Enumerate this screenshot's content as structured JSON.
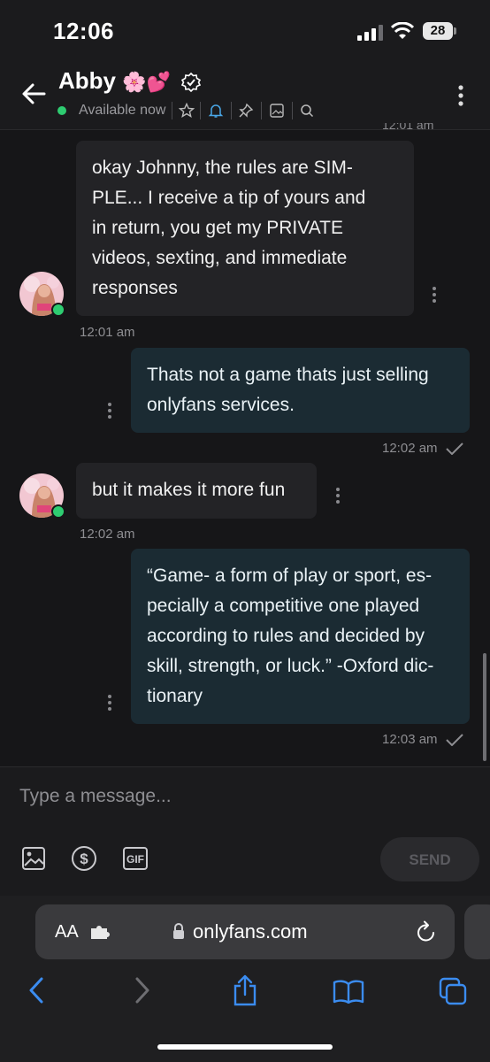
{
  "status_bar": {
    "time": "12:06",
    "battery": "28"
  },
  "header": {
    "name": "Abby",
    "name_emoji": "🌸💕",
    "presence": "Available now"
  },
  "clipped_timestamp": "12:01 am",
  "messages": [
    {
      "direction": "in",
      "text": "okay Johnny, the rules are SIM-PLE... I receive a tip of yours and in return, you get my PRIVATE videos, sexting, and immediate responses",
      "lines": [
        "okay Johnny, the rules are SIM-",
        "PLE... I receive a tip of yours and",
        "in return, you get my PRIVATE",
        "videos, sexting, and immediate",
        "responses"
      ],
      "time": "12:01 am"
    },
    {
      "direction": "out",
      "text": "Thats not a game thats just selling onlyfans services.",
      "lines": [
        "Thats not a game thats just selling",
        "onlyfans services."
      ],
      "time": "12:02 am"
    },
    {
      "direction": "in",
      "text": "but it makes it more fun",
      "lines": [
        "but it makes it more fun"
      ],
      "time": "12:02 am"
    },
    {
      "direction": "out",
      "text": "“Game- a form of play or sport, especially a competitive one played according to rules and decided by skill, strength, or luck.” -Oxford dictionary",
      "lines": [
        "“Game- a form of play or sport, es-",
        "pecially a competitive one played",
        "according to rules and decided by",
        "skill, strength, or luck.” -Oxford dic-",
        "tionary"
      ],
      "time": "12:03 am"
    }
  ],
  "composer": {
    "placeholder": "Type a message...",
    "send_label": "SEND"
  },
  "browser": {
    "aa": "AA",
    "url": "onlyfans.com"
  },
  "colors": {
    "online": "#2ecc71",
    "bell_accent": "#4aa8e8",
    "link_blue": "#3b8cf0"
  }
}
